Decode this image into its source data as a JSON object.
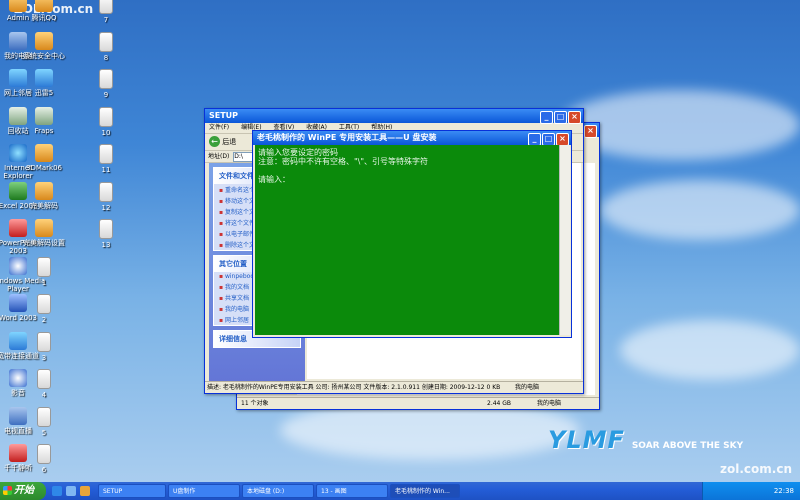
{
  "watermark": "ZOL.com.cn",
  "watermark_bottom": "zol.com.cn",
  "brand": {
    "logo": "YLMF",
    "slogan": "SOAR ABOVE THE SKY",
    "logo_color": "#2a9be0"
  },
  "desktop_icons": [
    {
      "label": "Admin",
      "icon": "folder-icon"
    },
    {
      "label": "腾讯QQ",
      "icon": "qq-icon"
    },
    {
      "label": "7",
      "icon": "document-icon"
    },
    {
      "label": "我的电脑",
      "icon": "computer-icon"
    },
    {
      "label": "系统安全中心",
      "icon": "shield-icon"
    },
    {
      "label": "8",
      "icon": "document-icon"
    },
    {
      "label": "网上邻居",
      "icon": "network-icon"
    },
    {
      "label": "迅雷5",
      "icon": "thunder-icon"
    },
    {
      "label": "9",
      "icon": "document-icon"
    },
    {
      "label": "回收站",
      "icon": "recycle-bin-icon"
    },
    {
      "label": "Fraps",
      "icon": "fraps-icon"
    },
    {
      "label": "10",
      "icon": "document-icon"
    },
    {
      "label": "Internet Explorer",
      "icon": "ie-icon"
    },
    {
      "label": "3DMark06",
      "icon": "3dmark-icon"
    },
    {
      "label": "11",
      "icon": "document-icon"
    },
    {
      "label": "Excel 2003",
      "icon": "excel-icon"
    },
    {
      "label": "完美解码",
      "icon": "player-icon"
    },
    {
      "label": "12",
      "icon": "document-icon"
    },
    {
      "label": "PowerPoint 2003",
      "icon": "powerpoint-icon"
    },
    {
      "label": "完美解码设置",
      "icon": "settings-icon"
    },
    {
      "label": "13",
      "icon": "document-icon"
    },
    {
      "label": "Windows Media Player",
      "icon": "media-player-icon"
    },
    {
      "label": "1",
      "icon": "document-icon"
    },
    {
      "label": "Word 2003",
      "icon": "word-icon"
    },
    {
      "label": "2",
      "icon": "document-icon"
    },
    {
      "label": "宽带连接通道",
      "icon": "broadband-icon"
    },
    {
      "label": "3",
      "icon": "document-icon"
    },
    {
      "label": "影音",
      "icon": "movie-icon"
    },
    {
      "label": "4",
      "icon": "document-icon"
    },
    {
      "label": "电视直播",
      "icon": "tv-icon"
    },
    {
      "label": "5",
      "icon": "document-icon"
    },
    {
      "label": "千千静听",
      "icon": "music-icon"
    },
    {
      "label": "6",
      "icon": "document-icon"
    }
  ],
  "explorer": {
    "title": "SETUP",
    "menu": [
      "文件(F)",
      "编辑(E)",
      "查看(V)",
      "收藏(A)",
      "工具(T)",
      "帮助(H)"
    ],
    "back_label": "后退",
    "address_label": "地址(D)",
    "address_value": "D:\\",
    "tasks_header": "文件和文件夹任务",
    "tasks": [
      "重命名这个文件",
      "移动这个文件",
      "复制这个文件",
      "将这个文件发布",
      "以电子邮件形式发送此文件",
      "删除这个文件"
    ],
    "places_header": "其它位置",
    "places": [
      "winpeboot",
      "我的文档",
      "共享文档",
      "我的电脑",
      "网上邻居"
    ],
    "details_header": "详细信息",
    "statusbar": "描述: 老毛桃制作的WinPE专用安装工具 公司: 扬州某公司 文件版本: 2.1.0.911 创建日期: 2009-12-12 0 KB",
    "statusbar_location": "我的电脑"
  },
  "back_window": {
    "statusbar_left": "11 个对象",
    "statusbar_size": "2.44 GB",
    "statusbar_location": "我的电脑"
  },
  "console": {
    "title": "老毛桃制作的 WinPE 专用安装工具——U 盘安装",
    "lines": [
      "请输入您要设定的密码",
      "注意：密码中不许有空格、\"\\\"、引号等特殊字符",
      "",
      "请输入："
    ]
  },
  "taskbar": {
    "start_label": "开始",
    "tasks": [
      "SETUP",
      "U盘制作",
      "本地磁盘 (D:)",
      "13 - 画图",
      "老毛桃制作的 Win..."
    ],
    "clock": "22:38"
  }
}
